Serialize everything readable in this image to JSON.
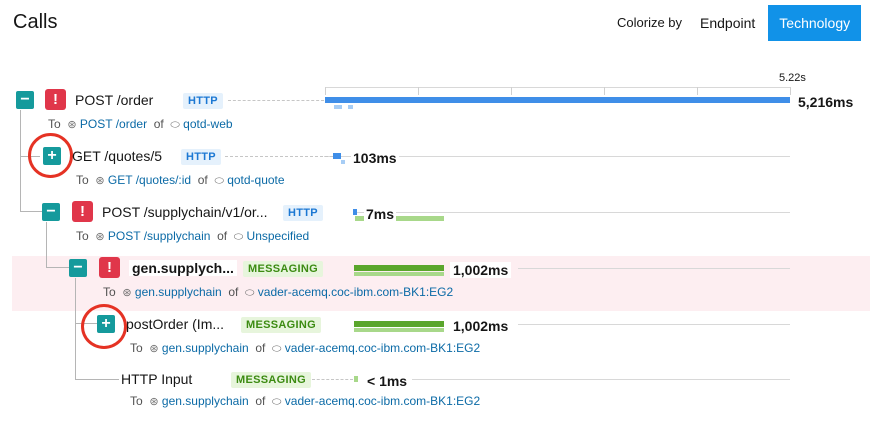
{
  "header": {
    "title": "Calls",
    "colorize_label": "Colorize by",
    "options": [
      "Endpoint",
      "Technology"
    ],
    "selected": "Technology"
  },
  "timeline": {
    "scale_label": "5.22s"
  },
  "rows": [
    {
      "toggle": "−",
      "error": "!",
      "name": "POST /order",
      "badge": "HTTP",
      "duration": "5,216ms",
      "to": "To",
      "target": "POST /order",
      "of": "of",
      "service": "qotd-web"
    },
    {
      "toggle": "+",
      "name": "GET /quotes/5",
      "badge": "HTTP",
      "duration": "103ms",
      "to": "To",
      "target": "GET /quotes/:id",
      "of": "of",
      "service": "qotd-quote"
    },
    {
      "toggle": "−",
      "error": "!",
      "name": "POST /supplychain/v1/or...",
      "badge": "HTTP",
      "duration": "7ms",
      "to": "To",
      "target": "POST /supplychain",
      "of": "of",
      "service": "Unspecified"
    },
    {
      "toggle": "−",
      "error": "!",
      "name": "gen.supplych...",
      "badge": "MESSAGING",
      "duration": "1,002ms",
      "to": "To",
      "target": "gen.supplychain",
      "of": "of",
      "service": "vader-acemq.coc-ibm.com-BK1:EG2"
    },
    {
      "toggle": "+",
      "name": "postOrder (Im...",
      "badge": "MESSAGING",
      "duration": "1,002ms",
      "to": "To",
      "target": "gen.supplychain",
      "of": "of",
      "service": "vader-acemq.coc-ibm.com-BK1:EG2"
    },
    {
      "name": "HTTP Input",
      "badge": "MESSAGING",
      "duration": "< 1ms",
      "to": "To",
      "target": "gen.supplychain",
      "of": "of",
      "service": "vader-acemq.coc-ibm.com-BK1:EG2"
    }
  ],
  "colors": {
    "http": "#3f8ee8",
    "messaging": "#5aa62c",
    "error": "#e0364a",
    "toggle": "#159a9c",
    "annotation": "#e53224"
  }
}
